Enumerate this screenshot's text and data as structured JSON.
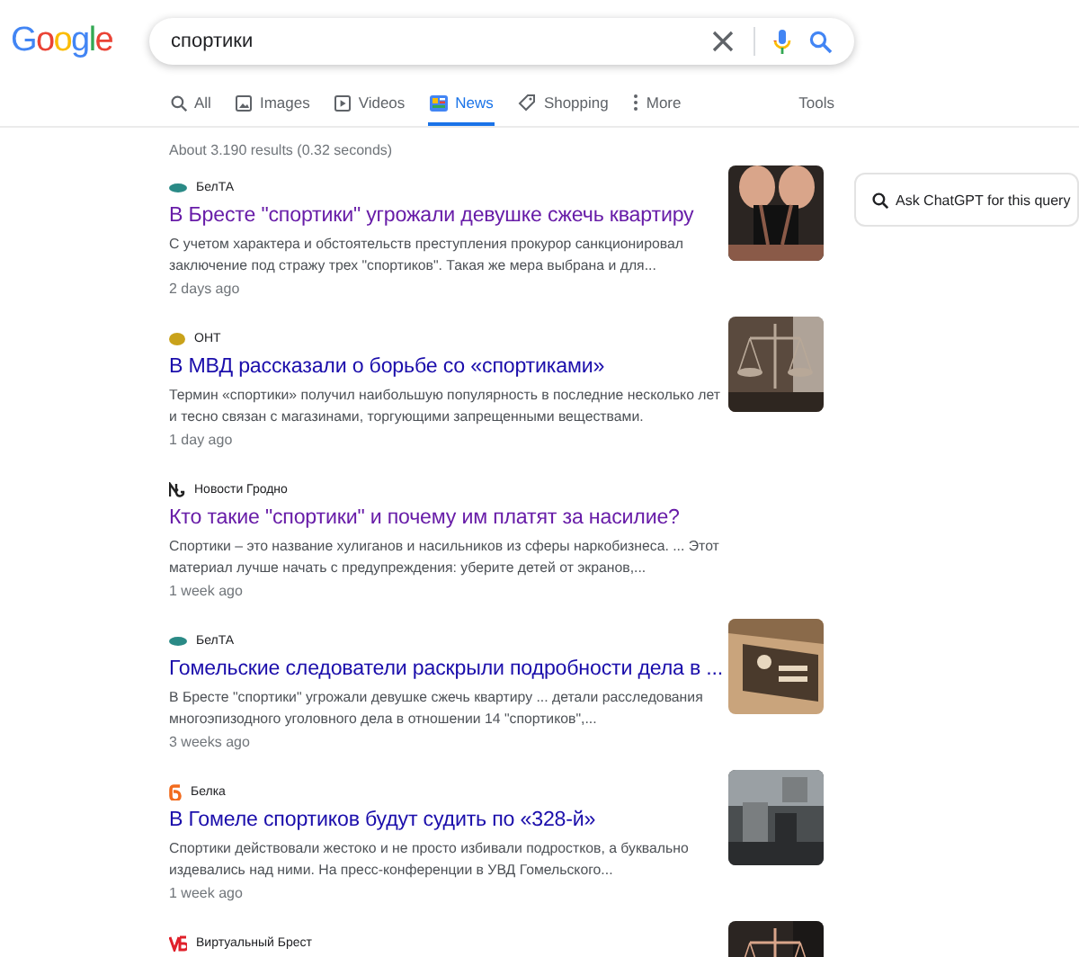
{
  "logo": "Google",
  "search": {
    "value": "спортики"
  },
  "tabs": [
    {
      "label": "All",
      "kind": "all",
      "selected": false
    },
    {
      "label": "Images",
      "kind": "images",
      "selected": false
    },
    {
      "label": "Videos",
      "kind": "videos",
      "selected": false
    },
    {
      "label": "News",
      "kind": "news",
      "selected": true
    },
    {
      "label": "Shopping",
      "kind": "shopping",
      "selected": false
    },
    {
      "label": "More",
      "kind": "more",
      "selected": false
    }
  ],
  "tools": "Tools",
  "result_stats": "About 3.190 results (0.32 seconds)",
  "results": [
    {
      "source": "БелТА",
      "source_logo": {
        "kind": "pill",
        "color": "#2a8a86"
      },
      "title": "В Бресте \"спортики\" угрожали девушке сжечь квартиру",
      "visited": true,
      "snippet": "С учетом характера и обстоятельств преступления прокурор санкционировал заключение под стражу трех \"спортиков\". Такая же мера выбрана и для...",
      "time": "2 days ago"
    },
    {
      "source": "ОНТ",
      "source_logo": {
        "kind": "coin",
        "color": "#c9a21a"
      },
      "title": "В МВД рассказали о борьбе со «спортиками»",
      "visited": false,
      "snippet": "Термин «спортики» получил наибольшую популярность в последние несколько лет и тесно связан с магазинами, торгующими запрещенными веществами.",
      "time": "1 day ago"
    },
    {
      "source": "Новости Гродно",
      "source_logo": {
        "kind": "mark",
        "color": "#222222"
      },
      "title": "Кто такие \"спортики\" и почему им платят за насилие?",
      "visited": true,
      "snippet": "Спортики – это название хулиганов и насильников из сферы наркобизнеса. ... Этот материал лучше начать с предупреждения: уберите детей от экранов,...",
      "time": "1 week ago"
    },
    {
      "source": "БелТА",
      "source_logo": {
        "kind": "pill",
        "color": "#2a8a86"
      },
      "title": "Гомельские следователи раскрыли подробности дела в ...",
      "visited": false,
      "snippet": "В Бресте \"спортики\" угрожали девушке сжечь квартиру ... детали расследования многоэпизодного уголовного дела в отношении 14 \"спортиков\",...",
      "time": "3 weeks ago"
    },
    {
      "source": "Белка",
      "source_logo": {
        "kind": "flame",
        "color": "#f26b1d"
      },
      "title": "В Гомеле спортиков будут судить по «328-й»",
      "visited": false,
      "snippet": "Спортики действовали жестоко и не просто избивали подростков, а буквально издевались над ними. На пресс-конференции в УВД Гомельского...",
      "time": "1 week ago"
    },
    {
      "source": "Виртуальный Брест",
      "source_logo": {
        "kind": "vmark",
        "color": "#e0202a"
      }
    }
  ],
  "side_button": "Ask ChatGPT for this query"
}
